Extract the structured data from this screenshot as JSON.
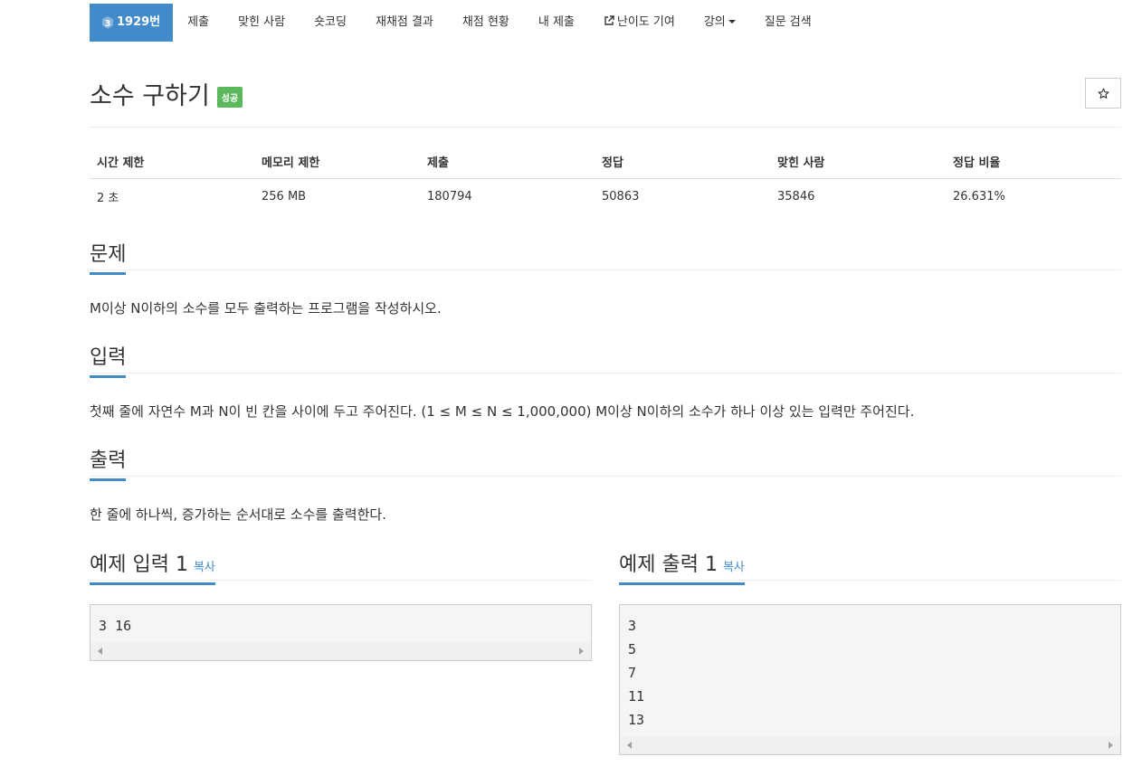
{
  "nav": {
    "problem_id": "1929번",
    "tier_level": "3",
    "items": [
      "제출",
      "맞힌 사람",
      "숏코딩",
      "재채점 결과",
      "채점 현황",
      "내 제출",
      "난이도 기여",
      "강의",
      "질문 검색"
    ]
  },
  "problem": {
    "title": "소수 구하기",
    "status_badge": "성공",
    "star": "☆"
  },
  "info_table": {
    "headers": [
      "시간 제한",
      "메모리 제한",
      "제출",
      "정답",
      "맞힌 사람",
      "정답 비율"
    ],
    "values": [
      "2 초",
      "256 MB",
      "180794",
      "50863",
      "35846",
      "26.631%"
    ]
  },
  "sections": {
    "description": {
      "heading": "문제",
      "text": "M이상 N이하의 소수를 모두 출력하는 프로그램을 작성하시오."
    },
    "input": {
      "heading": "입력",
      "text": "첫째 줄에 자연수 M과 N이 빈 칸을 사이에 두고 주어진다. (1 ≤ M ≤ N ≤ 1,000,000) M이상 N이하의 소수가 하나 이상 있는 입력만 주어진다."
    },
    "output": {
      "heading": "출력",
      "text": "한 줄에 하나씩, 증가하는 순서대로 소수를 출력한다."
    }
  },
  "samples": {
    "input": {
      "heading": "예제 입력 1",
      "copy_label": "복사",
      "content": "3 16"
    },
    "output": {
      "heading": "예제 출력 1",
      "copy_label": "복사",
      "content": "3\n5\n7\n11\n13"
    }
  },
  "colors": {
    "accent": "#428bca",
    "success": "#5cb85c",
    "sample_bg": "#f5f5f5"
  }
}
